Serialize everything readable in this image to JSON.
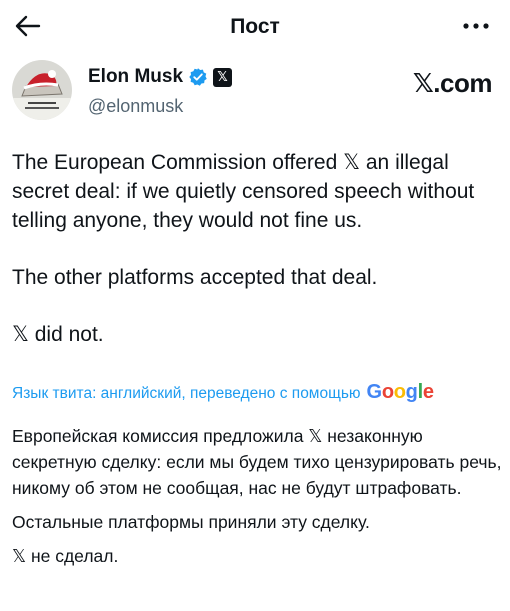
{
  "header": {
    "title": "Пост"
  },
  "author": {
    "name": "Elon Musk",
    "handle": "@elonmusk",
    "x_badge": "𝕏",
    "avatar_caption": "Avatar: Christmas hat on laptop photo"
  },
  "watermark": "𝕏.com",
  "tweet": {
    "p1": "The European Commission offered 𝕏 an illegal secret deal: if we quietly censored speech without telling anyone, they would not fine us.",
    "p2": "The other platforms accepted that deal.",
    "p3": "𝕏 did not."
  },
  "translation": {
    "label": "Язык твита: английский, переведено с помощью",
    "google": {
      "g1": "G",
      "o1": "o",
      "o2": "o",
      "g2": "g",
      "l": "l",
      "e": "e"
    },
    "p1": "Европейская комиссия предложила 𝕏 незаконную секретную сделку: если мы будем тихо цензурировать речь, никому об этом не сообщая, нас не будут штрафовать.",
    "p2": "Остальные платформы приняли эту сделку.",
    "p3": "𝕏 не сделал."
  },
  "colors": {
    "text": "#0f1419",
    "secondary": "#536471",
    "link": "#1d9bf0",
    "verified": "#1d9bf0"
  },
  "icons": {
    "back": "arrow-left-icon",
    "more": "more-horizontal-icon",
    "verified": "verified-badge-icon",
    "x_badge": "x-logo-icon"
  }
}
